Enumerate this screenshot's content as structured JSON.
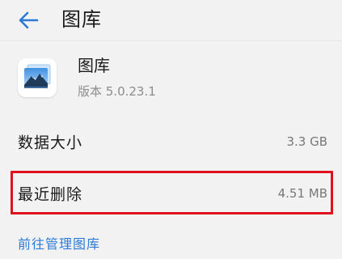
{
  "header": {
    "title": "图库",
    "back_icon": "arrow-left-icon"
  },
  "app": {
    "name": "图库",
    "version": "版本 5.0.23.1",
    "icon": "gallery-app-icon"
  },
  "storage": {
    "data_size_label": "数据大小",
    "data_size_value": "3.3 GB",
    "recently_deleted_label": "最近删除",
    "recently_deleted_value": "4.51 MB"
  },
  "actions": {
    "manage_link": "前往管理图库"
  },
  "colors": {
    "accent": "#2c7ad6",
    "highlight": "#e0101f",
    "background": "#f2f2f2"
  }
}
